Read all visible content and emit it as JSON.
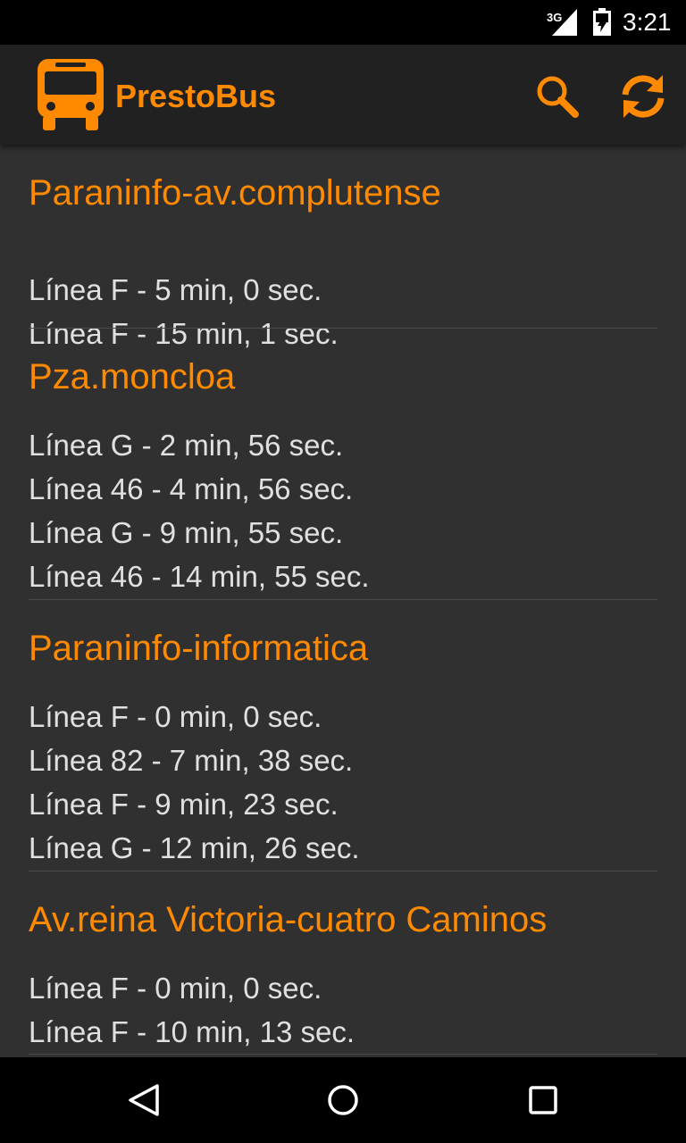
{
  "status_bar": {
    "network": "3G",
    "time": "3:21"
  },
  "app_bar": {
    "title": "PrestoBus",
    "logo_icon": "bus-icon",
    "actions": [
      {
        "icon": "search-icon"
      },
      {
        "icon": "refresh-icon"
      }
    ]
  },
  "colors": {
    "accent": "#ff8a00",
    "background": "#303030",
    "app_bar": "#212121",
    "text": "#e0e0e0",
    "divider": "#4a4a4a"
  },
  "stops": [
    {
      "name": "Paraninfo-av.complutense",
      "arrivals": [
        "Línea F - 5 min, 0 sec.",
        "Línea F - 15 min, 1 sec."
      ]
    },
    {
      "name": "Pza.moncloa",
      "arrivals": [
        "Línea G - 2 min, 56 sec.",
        "Línea 46 - 4 min, 56 sec.",
        "Línea G - 9 min, 55 sec.",
        "Línea 46 - 14 min, 55 sec."
      ]
    },
    {
      "name": "Paraninfo-informatica",
      "arrivals": [
        "Línea F - 0 min, 0 sec.",
        "Línea 82 - 7 min, 38 sec.",
        "Línea F - 9 min, 23 sec.",
        "Línea G - 12 min, 26 sec."
      ]
    },
    {
      "name": "Av.reina Victoria-cuatro Caminos",
      "arrivals": [
        "Línea F - 0 min, 0 sec.",
        "Línea F - 10 min, 13 sec."
      ]
    }
  ],
  "nav_bar": {
    "buttons": [
      {
        "icon": "back-icon"
      },
      {
        "icon": "home-icon"
      },
      {
        "icon": "recents-icon"
      }
    ]
  }
}
